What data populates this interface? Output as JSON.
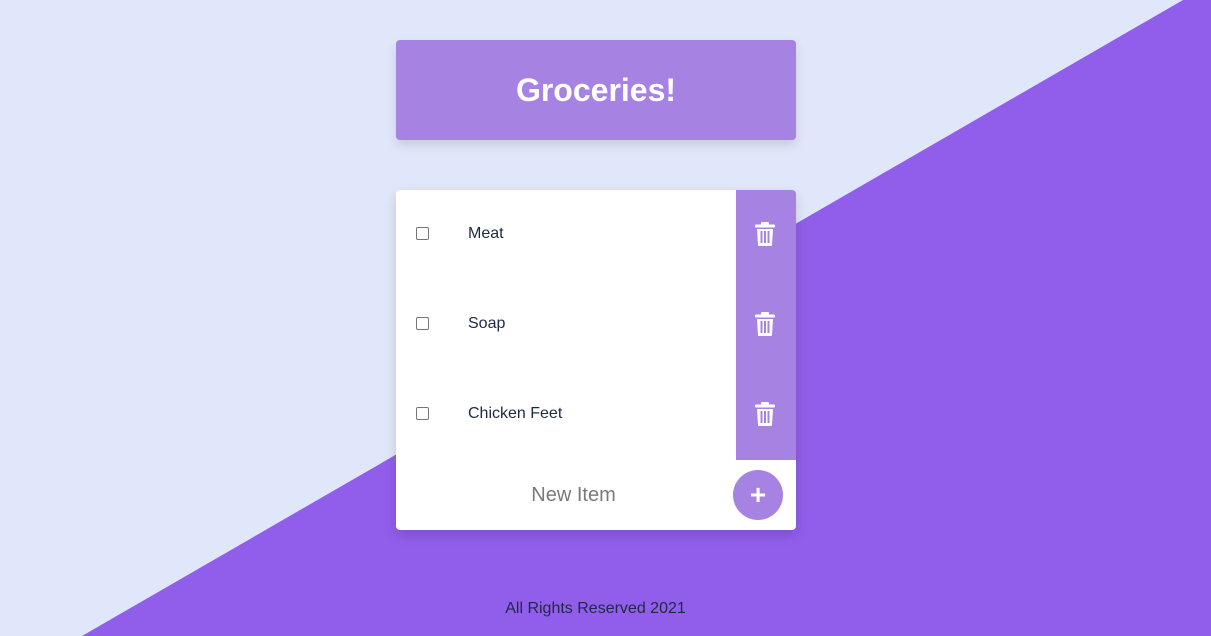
{
  "header": {
    "title": "Groceries!"
  },
  "list": {
    "items": [
      {
        "label": "Meat",
        "checked": false,
        "delete_icon": "trash-icon"
      },
      {
        "label": "Soap",
        "checked": false,
        "delete_icon": "trash-icon"
      },
      {
        "label": "Chicken Feet",
        "checked": false,
        "delete_icon": "trash-icon"
      }
    ]
  },
  "new_item": {
    "placeholder": "New Item",
    "add_label": "+"
  },
  "footer": {
    "text": "All Rights Reserved 2021"
  },
  "colors": {
    "background_light": "#e1e7fa",
    "background_accent": "#915eeb",
    "card_accent": "#a683e3",
    "text_dark": "#1d2a44"
  }
}
